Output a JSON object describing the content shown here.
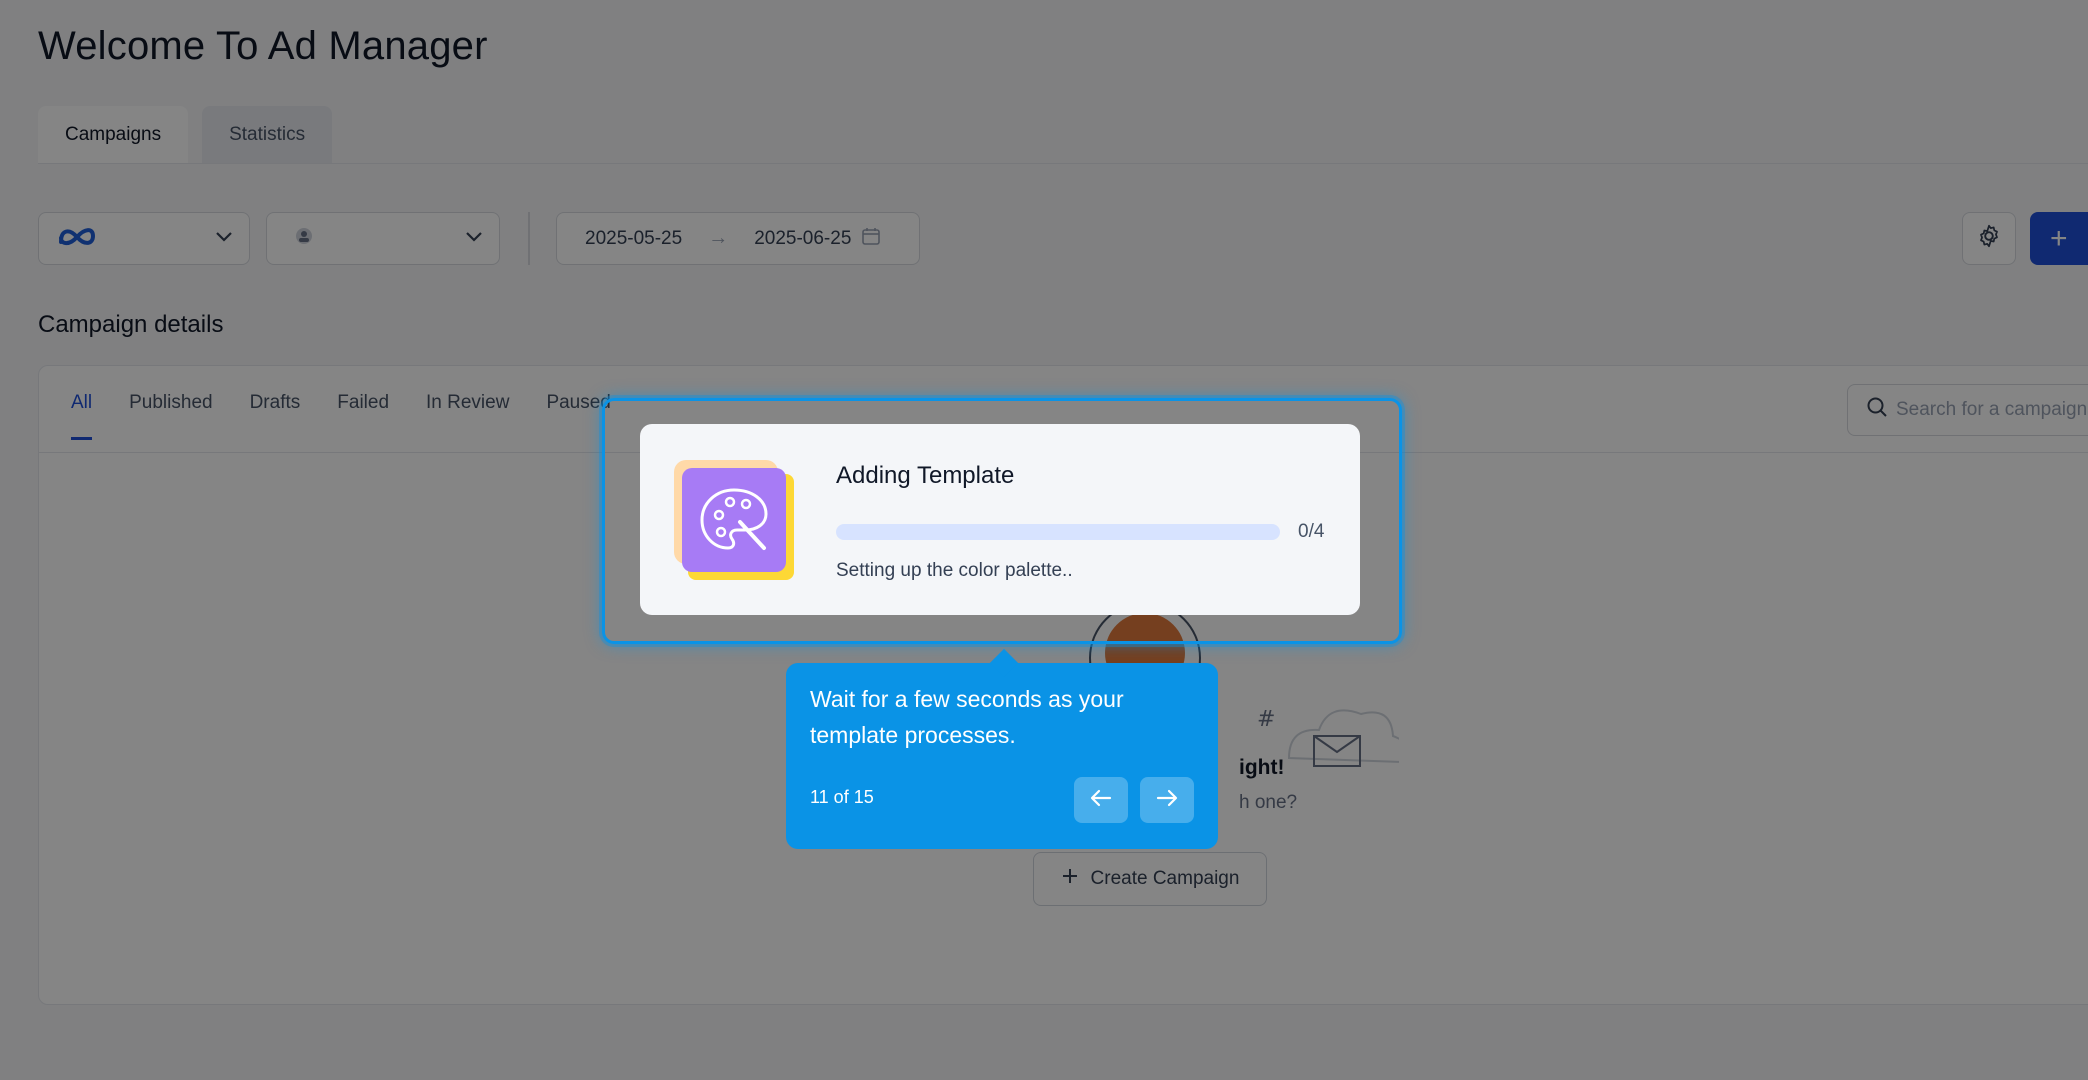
{
  "header": {
    "title": "Welcome To Ad Manager"
  },
  "tabs": [
    {
      "label": "Campaigns",
      "active": true
    },
    {
      "label": "Statistics",
      "active": false
    }
  ],
  "filters": {
    "platform_icon": "meta-logo-icon",
    "account_icon": "account-avatar-icon",
    "date_start": "2025-05-25",
    "date_end": "2025-06-25"
  },
  "section": {
    "title": "Campaign details"
  },
  "campaign_tabs": [
    "All",
    "Published",
    "Drafts",
    "Failed",
    "In Review",
    "Paused"
  ],
  "search": {
    "placeholder": "Search for a campaign"
  },
  "empty_state": {
    "title_partial": "ight!",
    "subtitle_partial": "h one?",
    "create_button": "Create Campaign"
  },
  "modal": {
    "title": "Adding Template",
    "progress_count": "0/4",
    "progress_fraction": 0,
    "status": "Setting up the color palette..",
    "icon": "palette-icon"
  },
  "tour": {
    "message": "Wait for a few seconds as your template processes.",
    "step": "11 of 15"
  },
  "colors": {
    "accent": "#1f4fd8",
    "tour_blue": "#0a93e6",
    "progress_track": "#d7e3ff",
    "thumb_purple": "#a77bf5",
    "thumb_yellow": "#fdd835",
    "thumb_peach": "#ffd9a8"
  }
}
